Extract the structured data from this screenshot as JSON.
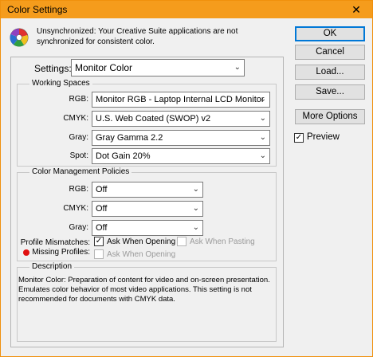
{
  "window": {
    "title": "Color Settings",
    "close_glyph": "✕"
  },
  "info": {
    "icon": "color-wheel-icon",
    "message": "Unsynchronized: Your Creative Suite applications are not synchronized for consistent color."
  },
  "buttons": {
    "ok": "OK",
    "cancel": "Cancel",
    "load": "Load...",
    "save": "Save...",
    "more_options": "More Options"
  },
  "preview": {
    "label": "Preview",
    "checked": true
  },
  "settings": {
    "label": "Settings:",
    "value": "Monitor Color"
  },
  "working_spaces": {
    "title": "Working Spaces",
    "rgb": {
      "label": "RGB:",
      "value": "Monitor RGB - Laptop Internal LCD Monitor"
    },
    "cmyk": {
      "label": "CMYK:",
      "value": "U.S. Web Coated (SWOP) v2"
    },
    "gray": {
      "label": "Gray:",
      "value": "Gray Gamma 2.2"
    },
    "spot": {
      "label": "Spot:",
      "value": "Dot Gain 20%"
    }
  },
  "policies": {
    "title": "Color Management Policies",
    "rgb": {
      "label": "RGB:",
      "value": "Off"
    },
    "cmyk": {
      "label": "CMYK:",
      "value": "Off"
    },
    "gray": {
      "label": "Gray:",
      "value": "Off"
    },
    "profile_mismatches": {
      "label": "Profile Mismatches:",
      "ask_opening": "Ask When Opening",
      "ask_pasting": "Ask When Pasting"
    },
    "missing_profiles": {
      "label": "Missing Profiles:",
      "ask_opening": "Ask When Opening"
    }
  },
  "description": {
    "title": "Description",
    "text": "Monitor Color: Preparation of content for video and on-screen presentation. Emulates color behavior of most video applications. This setting is not recommended for documents with CMYK data."
  },
  "colors": {
    "titlebar": "#f59c1c",
    "default_button_border": "#0078d7",
    "missing_dot": "#e01010"
  }
}
